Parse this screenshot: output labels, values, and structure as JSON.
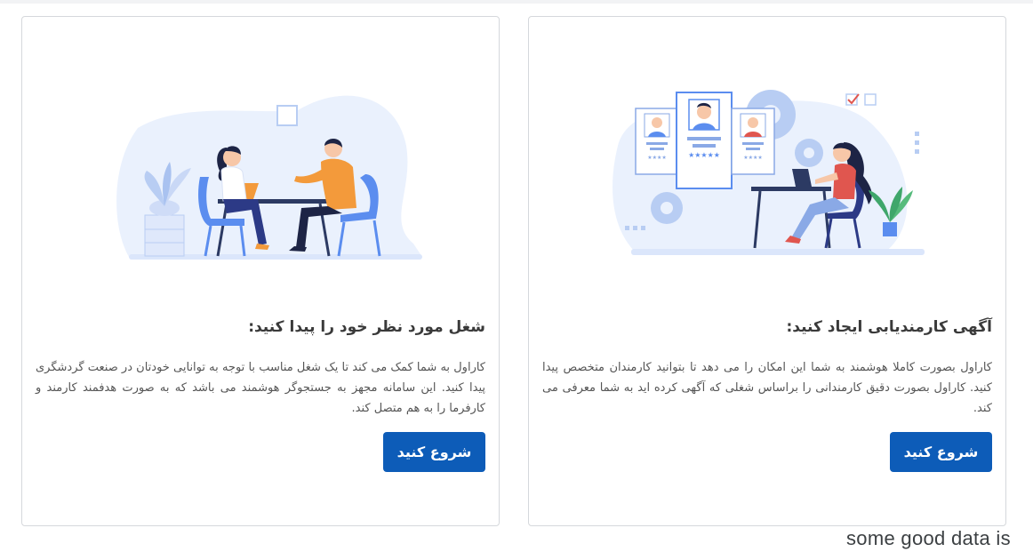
{
  "cards": [
    {
      "title": "شغل مورد نظر خود را پیدا کنید:",
      "description": "کاراول به شما کمک می کند تا یک شغل مناسب با توجه به توانایی خودتان در صنعت گردشگری پیدا کنید. این سامانه مجهز به جستجوگر هوشمند می باشد که به صورت هدفمند کارمند و کارفرما را به هم متصل کند.",
      "button_label": "شروع کنید",
      "illustration": "job-interview-illustration"
    },
    {
      "title": "آگهی کارمندیابی ایجاد کنید:",
      "description": "کاراول بصورت کاملا هوشمند به شما این امکان را می دهد تا بتوانید کارمندان متخصص پیدا کنید. کاراول بصورت دقیق کارمندانی را براساس شغلی که آگهی کرده اید به شما معرفی می کند.",
      "button_label": "شروع کنید",
      "illustration": "recruiter-resumes-illustration"
    }
  ],
  "footer_text": "some good data is",
  "colors": {
    "button": "#0d5cb8",
    "card_border": "#d5d8dc",
    "accent_blue": "#5b8def",
    "accent_orange": "#f39a3b"
  }
}
